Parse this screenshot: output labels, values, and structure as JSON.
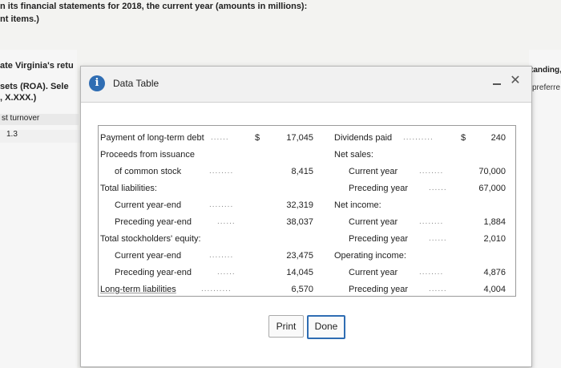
{
  "background": {
    "line1": "n its financial statements for 2018, the current year (amounts in millions):",
    "line2": "nt items.)",
    "left_snip1": "ate Virginia's retu",
    "left_snip2": "sets (ROA). Sele",
    "left_snip3": ", X.XXX.)",
    "turnover_header": "st turnover",
    "turnover_value": "1.3",
    "right_snip1": "tanding,",
    "right_snip2": "preferre"
  },
  "modal": {
    "title": "Data Table",
    "print_label": "Print",
    "done_label": "Done"
  },
  "table": {
    "left": [
      {
        "label": "Payment of long-term debt",
        "dollar": "$",
        "value": "17,045"
      },
      {
        "label": "Proceeds from issuance",
        "value": ""
      },
      {
        "label": "of common stock",
        "value": "8,415"
      },
      {
        "label": "Total liabilities:",
        "value": ""
      },
      {
        "label": "Current year-end",
        "value": "32,319"
      },
      {
        "label": "Preceding year-end",
        "value": "38,037"
      },
      {
        "label": "Total stockholders' equity:",
        "value": ""
      },
      {
        "label": "Current year-end",
        "value": "23,475"
      },
      {
        "label": "Preceding year-end",
        "value": "14,045"
      },
      {
        "label": "Long-term liabilities",
        "value": "6,570"
      }
    ],
    "right": [
      {
        "label": "Dividends paid",
        "dollar": "$",
        "value": "240"
      },
      {
        "label": "Net sales:",
        "value": ""
      },
      {
        "label": "Current year",
        "value": "70,000"
      },
      {
        "label": "Preceding year",
        "value": "67,000"
      },
      {
        "label": "Net income:",
        "value": ""
      },
      {
        "label": "Current year",
        "value": "1,884"
      },
      {
        "label": "Preceding year",
        "value": "2,010"
      },
      {
        "label": "Operating income:",
        "value": ""
      },
      {
        "label": "Current year",
        "value": "4,876"
      },
      {
        "label": "Preceding year",
        "value": "4,004"
      }
    ]
  }
}
